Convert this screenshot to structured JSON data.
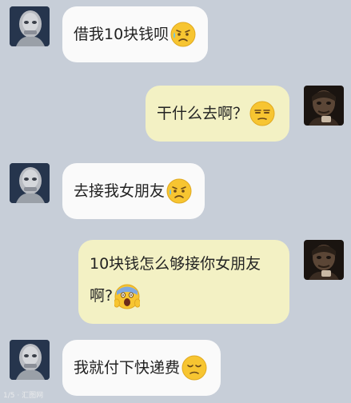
{
  "messages": [
    {
      "side": "left",
      "text": "借我10块钱呗",
      "emoji_icon": "anxious-sweat-face-emoji"
    },
    {
      "side": "right",
      "text": "干什么去啊？",
      "emoji_icon": "unamused-face-emoji"
    },
    {
      "side": "left",
      "text": "去接我女朋友",
      "emoji_icon": "anxious-sweat-face-emoji"
    },
    {
      "side": "right",
      "line1": "10块钱怎么够接你女朋友",
      "line2": "啊?",
      "emoji_icon": "screaming-fear-face-emoji"
    },
    {
      "side": "left",
      "text": "我就付下快递费",
      "emoji_icon": "pensive-face-emoji"
    }
  ],
  "colors": {
    "background": "#c7ced8",
    "left_bubble": "#fafafa",
    "right_bubble": "#f3f1c4",
    "emoji_yellow": "#f7c531"
  },
  "watermark": "1/5 · 汇图网"
}
